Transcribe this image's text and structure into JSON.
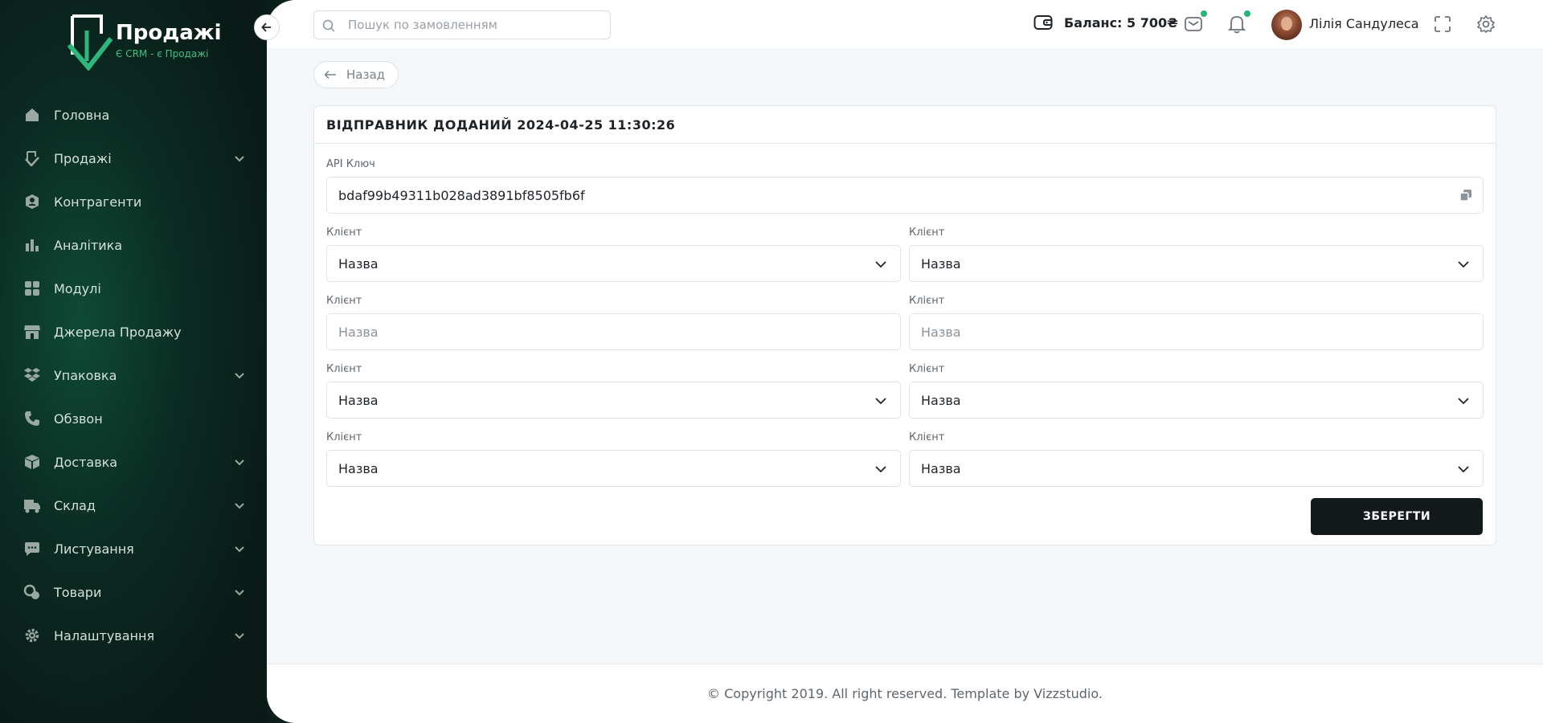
{
  "brand": {
    "title": "Продажі",
    "subtitle": "Є CRM - є Продажі"
  },
  "sidebar": {
    "items": [
      {
        "label": "Головна",
        "icon": "home-icon",
        "expandable": false
      },
      {
        "label": "Продажі",
        "icon": "sales-icon",
        "expandable": true
      },
      {
        "label": "Контрагенти",
        "icon": "contractors-icon",
        "expandable": false
      },
      {
        "label": "Аналітика",
        "icon": "analytics-icon",
        "expandable": false
      },
      {
        "label": "Модулі",
        "icon": "modules-icon",
        "expandable": false
      },
      {
        "label": "Джерела Продажу",
        "icon": "store-icon",
        "expandable": false
      },
      {
        "label": "Упаковка",
        "icon": "packaging-icon",
        "expandable": true
      },
      {
        "label": "Обзвон",
        "icon": "phone-icon",
        "expandable": false
      },
      {
        "label": "Доставка",
        "icon": "delivery-icon",
        "expandable": true
      },
      {
        "label": "Склад",
        "icon": "warehouse-icon",
        "expandable": true
      },
      {
        "label": "Листування",
        "icon": "chat-icon",
        "expandable": true
      },
      {
        "label": "Товари",
        "icon": "products-icon",
        "expandable": true
      },
      {
        "label": "Налаштування",
        "icon": "settings-icon",
        "expandable": true
      }
    ]
  },
  "topbar": {
    "search_placeholder": "Пошук по замовленням",
    "balance": "Баланс: 5 700₴",
    "user_name": "Лілія Сандулеса"
  },
  "content": {
    "back_label": "Назад",
    "card_title": "ВІДПРАВНИК ДОДАНИЙ 2024-04-25 11:30:26",
    "api_key_label": "API Ключ",
    "api_key_value": "bdaf99b49311b028ad3891bf8505fb6f",
    "fields": [
      {
        "label": "Клієнт",
        "value": "Назва",
        "kind": "select"
      },
      {
        "label": "Клієнт",
        "value": "Назва",
        "kind": "select"
      },
      {
        "label": "Клієнт",
        "placeholder": "Назва",
        "kind": "input"
      },
      {
        "label": "Клієнт",
        "placeholder": "Назва",
        "kind": "input"
      },
      {
        "label": "Клієнт",
        "value": "Назва",
        "kind": "select"
      },
      {
        "label": "Клієнт",
        "value": "Назва",
        "kind": "select"
      },
      {
        "label": "Клієнт",
        "value": "Назва",
        "kind": "select"
      },
      {
        "label": "Клієнт",
        "value": "Назва",
        "kind": "select"
      }
    ],
    "save_label": "ЗБЕРЕГТИ"
  },
  "footer": {
    "text": "© Copyright 2019. All right reserved. Template by Vizzstudio."
  },
  "colors": {
    "accent": "#22b573",
    "sidebar_dark": "#0a1c18",
    "button_dark": "#14191b"
  }
}
